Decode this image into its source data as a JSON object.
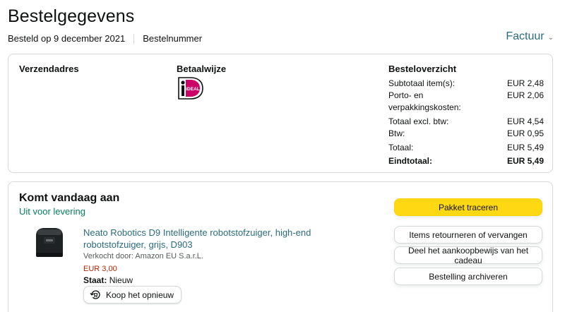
{
  "header": {
    "title": "Bestelgegevens",
    "ordered_on": "Besteld op 9 december 2021",
    "order_number_label": "Bestelnummer",
    "invoice_label": "Factuur"
  },
  "details": {
    "shipping_address_title": "Verzendadres",
    "payment_method_title": "Betaalwijze",
    "payment_logo_text": "iDEAL",
    "summary": {
      "title": "Besteloverzicht",
      "rows": [
        {
          "label": "Subtotaal item(s):",
          "value": "EUR 2,48"
        },
        {
          "label": "Porto- en verpakkingskosten:",
          "value": "EUR 2,06"
        },
        {
          "label": "Totaal excl. btw:",
          "value": "EUR 4,54"
        },
        {
          "label": "Btw:",
          "value": "EUR 0,95"
        },
        {
          "label": "Totaal:",
          "value": "EUR 5,49"
        }
      ],
      "grand_total": {
        "label": "Eindtotaal:",
        "value": "EUR 5,49"
      }
    }
  },
  "shipment": {
    "title": "Komt vandaag aan",
    "status": "Uit voor levering",
    "product": {
      "title": "Neato Robotics D9 Intelligente robotstofzuiger, high-end robotstofzuiger, grijs, D903",
      "seller": "Verkocht door: Amazon EU S.a.r.L.",
      "price": "EUR 3,00",
      "state_label": "Staat:",
      "state_value": "Nieuw",
      "rebuy_label": "Koop het opnieuw"
    },
    "actions": {
      "track": "Pakket traceren",
      "return": "Items retourneren of vervangen",
      "share_gift": "Deel het aankoopbewijs van het cadeau",
      "archive": "Bestelling archiveren"
    }
  },
  "colors": {
    "link": "#2a6c7c",
    "success": "#067d62",
    "price": "#b12704",
    "primary_button": "#ffd814",
    "ideal_brand": "#cc0066"
  }
}
